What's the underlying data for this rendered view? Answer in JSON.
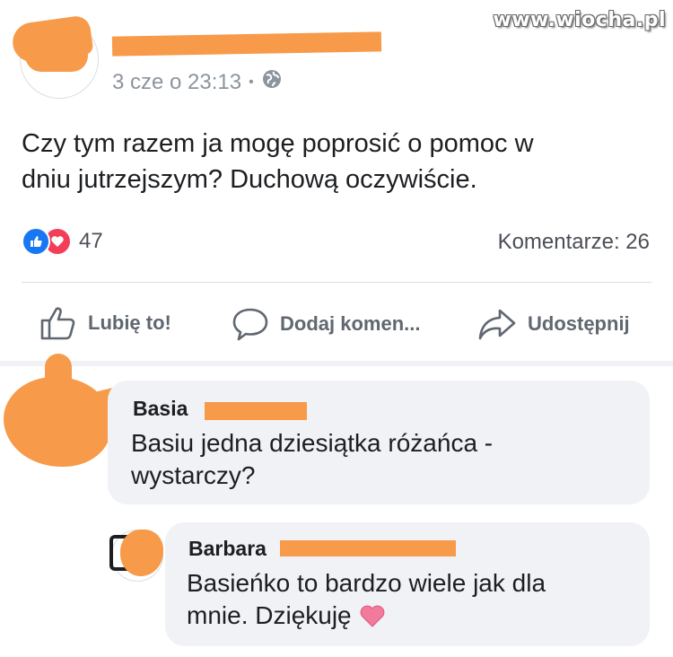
{
  "watermark": "www.wiocha.pl",
  "post": {
    "timestamp": "3 cze o 23:13",
    "separator": "•",
    "privacy_icon": "globe-icon",
    "text_line1": "Czy tym razem ja mogę poprosić o pomoc w",
    "text_line2": "dniu jutrzejszym? Duchową oczywiście.",
    "reaction_icons": [
      "like-icon",
      "love-icon"
    ],
    "reaction_count": "47",
    "comments_label": "Komentarze: 26"
  },
  "actions": {
    "like": "Lubię to!",
    "comment": "Dodaj komen...",
    "share": "Udostępnij"
  },
  "comments": [
    {
      "author": "Basia",
      "text_line1": "Basiu jedna dziesiątka różańca -",
      "text_line2": "wystarczy?"
    },
    {
      "author": "Barbara",
      "text_line1": "Basieńko to bardzo wiele jak dla",
      "text_line2": "mnie. Dziękuję"
    }
  ],
  "colors": {
    "like_blue": "#1877f2",
    "love_red": "#f33e58",
    "redaction": "#f79a4a",
    "bubble_bg": "#f0f2f5",
    "muted_text": "#8d949e"
  }
}
